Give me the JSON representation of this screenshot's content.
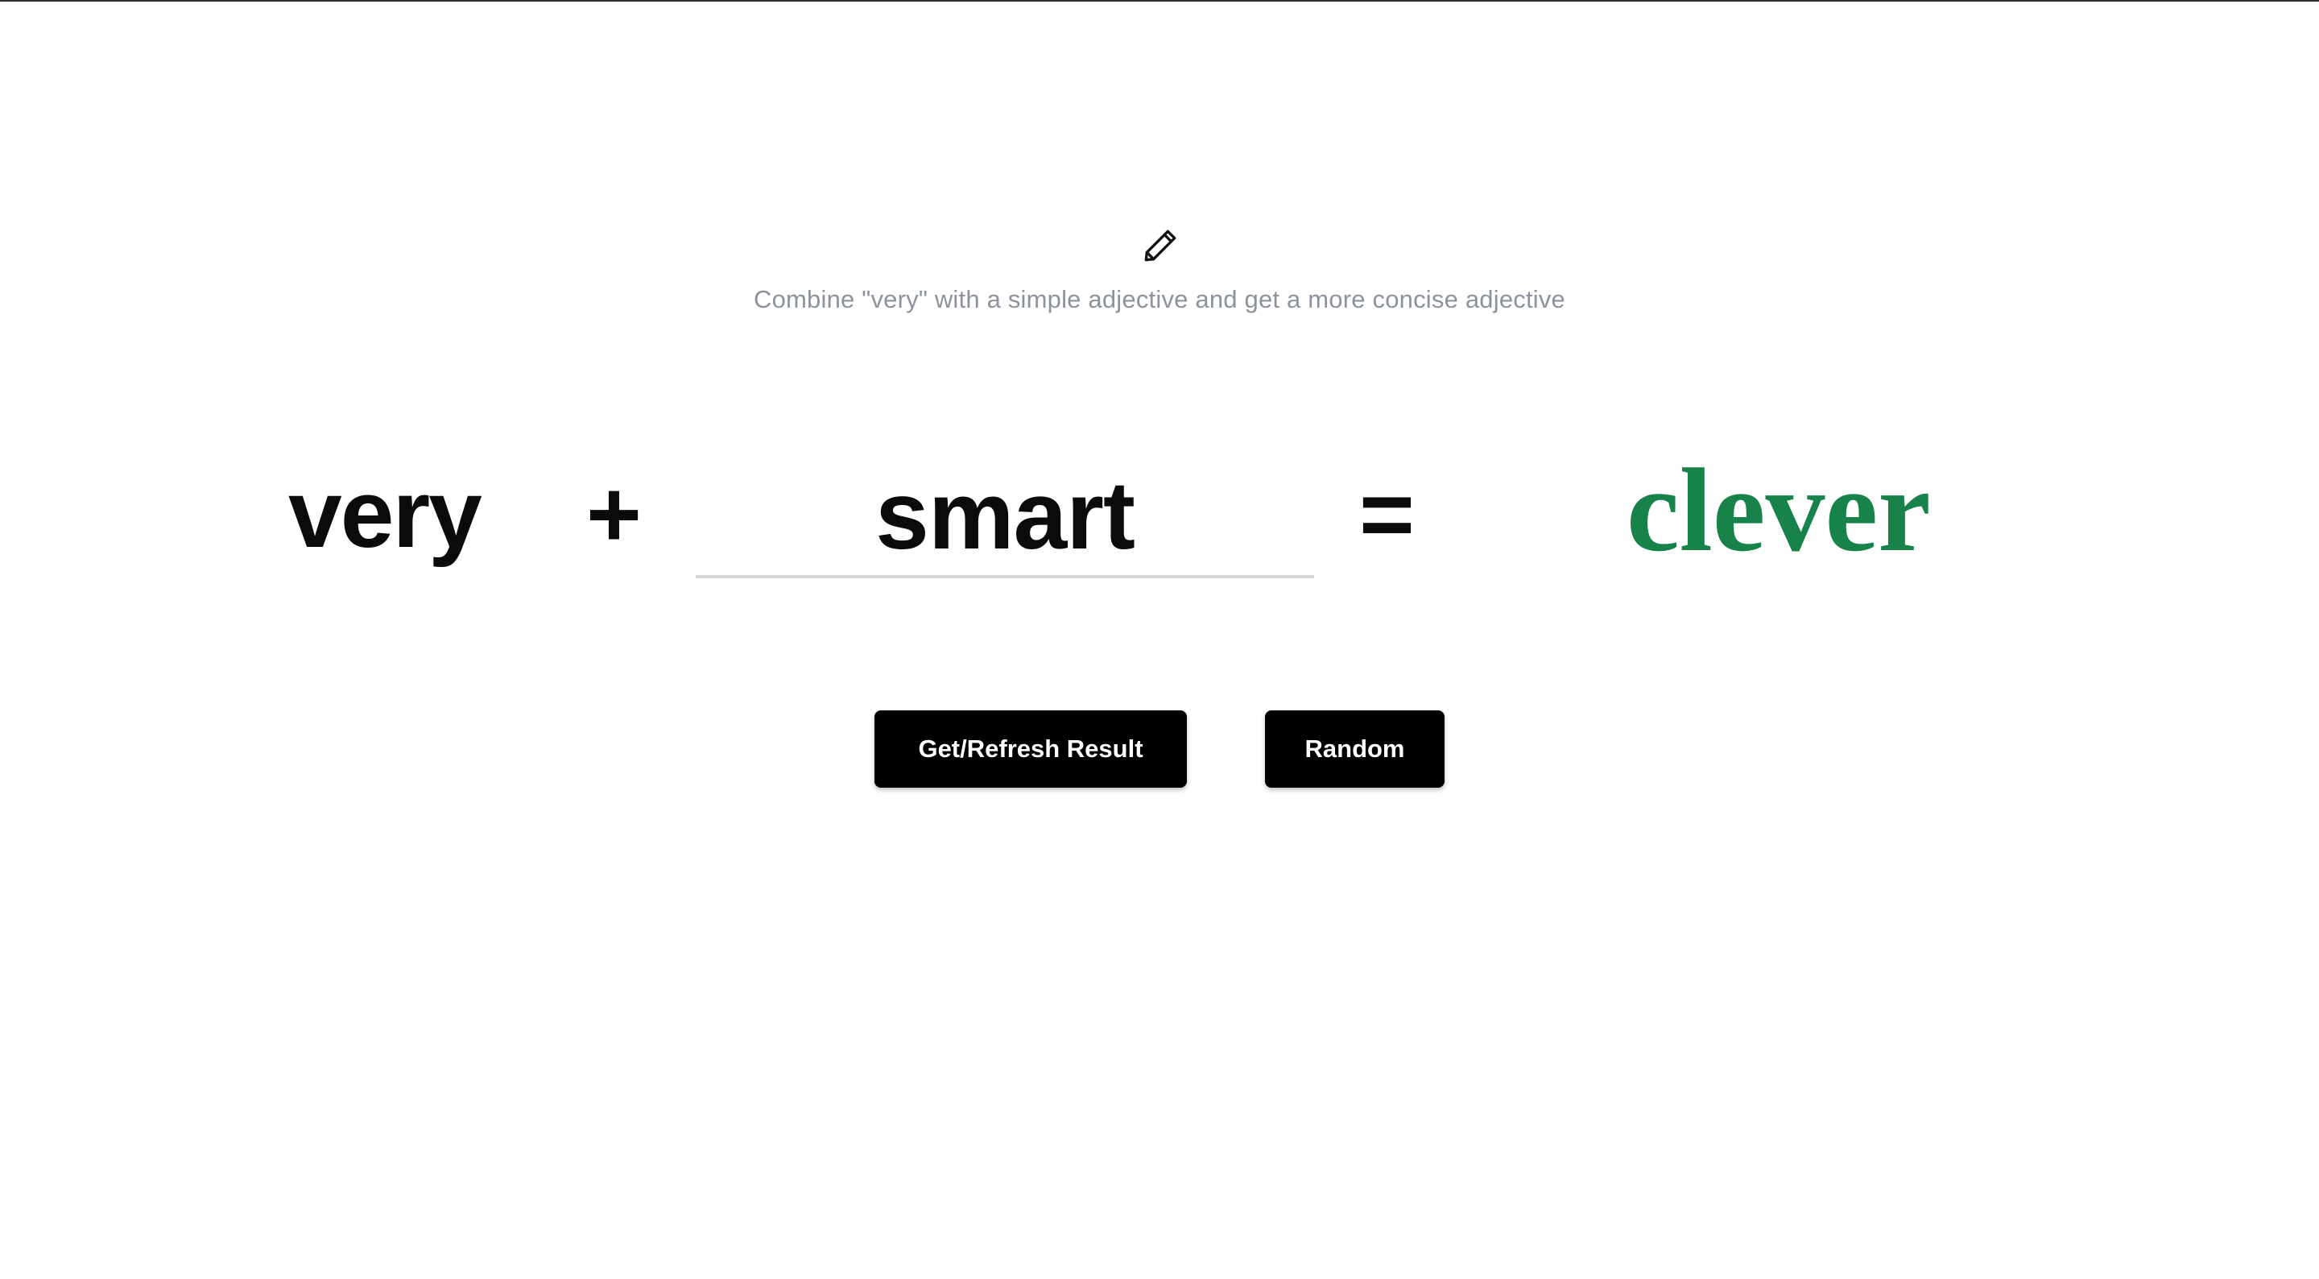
{
  "header": {
    "icon": "pencil-icon",
    "subtitle": "Combine \"very\" with a simple adjective and get a more concise adjective"
  },
  "equation": {
    "prefix": "very",
    "plus_sign": "+",
    "input_value": "smart",
    "equals_sign": "=",
    "result": "clever"
  },
  "buttons": {
    "refresh_label": "Get/Refresh Result",
    "random_label": "Random"
  },
  "colors": {
    "result": "#17834a",
    "button_bg": "#000000",
    "subtitle": "#8c939d"
  }
}
